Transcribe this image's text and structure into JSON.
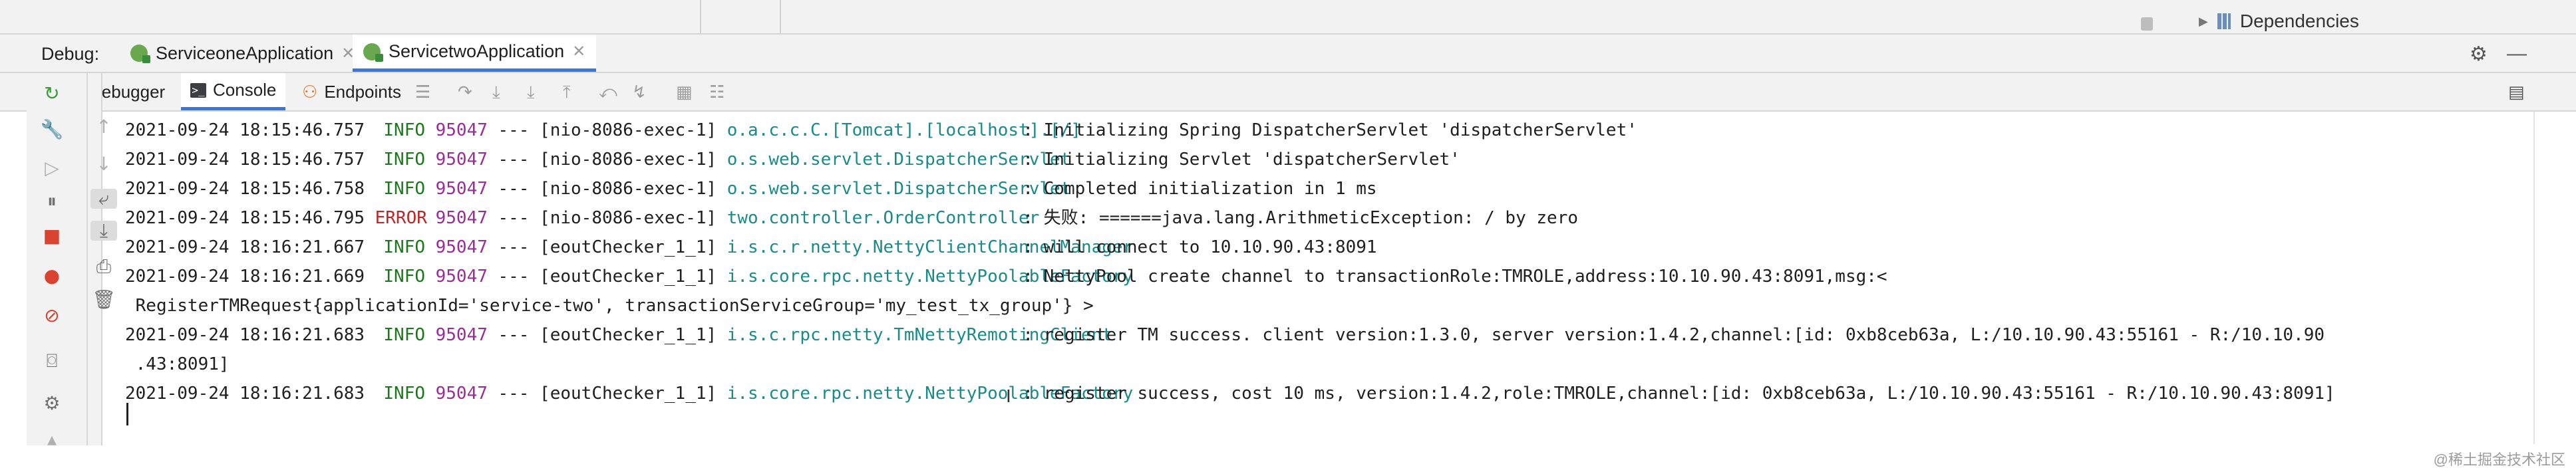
{
  "top": {
    "dependencies_label": "Dependencies"
  },
  "debug_bar": {
    "label": "Debug:",
    "tabs": [
      {
        "name": "ServiceoneApplication",
        "active": false
      },
      {
        "name": "ServicetwoApplication",
        "active": true
      }
    ],
    "right_icons": [
      "gear-icon",
      "minimize-icon"
    ]
  },
  "tool_bar": {
    "tabs": [
      {
        "label": "Debugger",
        "active": false
      },
      {
        "label": "Console",
        "active": true
      },
      {
        "label": "Endpoints",
        "active": false
      }
    ],
    "icons": [
      "menu-icon",
      "step-over-icon",
      "step-into-icon",
      "force-step-into-icon",
      "step-out-icon",
      "drop-frame-icon",
      "run-to-cursor-icon",
      "evaluate-icon",
      "trace-icon",
      "layout-icon"
    ]
  },
  "log": [
    {
      "ts": "2021-09-24 18:15:46.757",
      "level": "INFO",
      "pid": "95047",
      "sep": "---",
      "thread": "[nio-8086-exec-1]",
      "logger": "o.a.c.c.C.[Tomcat].[localhost].[/]",
      "message": ": Initializing Spring DispatcherServlet 'dispatcherServlet'"
    },
    {
      "ts": "2021-09-24 18:15:46.757",
      "level": "INFO",
      "pid": "95047",
      "sep": "---",
      "thread": "[nio-8086-exec-1]",
      "logger": "o.s.web.servlet.DispatcherServlet",
      "message": ": Initializing Servlet 'dispatcherServlet'"
    },
    {
      "ts": "2021-09-24 18:15:46.758",
      "level": "INFO",
      "pid": "95047",
      "sep": "---",
      "thread": "[nio-8086-exec-1]",
      "logger": "o.s.web.servlet.DispatcherServlet",
      "message": ": Completed initialization in 1 ms"
    },
    {
      "ts": "2021-09-24 18:15:46.795",
      "level": "ERROR",
      "pid": "95047",
      "sep": "---",
      "thread": "[nio-8086-exec-1]",
      "logger": "two.controller.OrderController",
      "message": ": 失败: ======java.lang.ArithmeticException: / by zero"
    },
    {
      "ts": "2021-09-24 18:16:21.667",
      "level": "INFO",
      "pid": "95047",
      "sep": "---",
      "thread": "[eoutChecker_1_1]",
      "logger": "i.s.c.r.netty.NettyClientChannelManager",
      "message": ": will connect to 10.10.90.43:8091"
    },
    {
      "ts": "2021-09-24 18:16:21.669",
      "level": "INFO",
      "pid": "95047",
      "sep": "---",
      "thread": "[eoutChecker_1_1]",
      "logger": "i.s.core.rpc.netty.NettyPoolableFactory",
      "message": ": NettyPool create channel to transactionRole:TMROLE,address:10.10.90.43:8091,msg:<"
    },
    {
      "continuation": " RegisterTMRequest{applicationId='service-two', transactionServiceGroup='my_test_tx_group'} >"
    },
    {
      "ts": "2021-09-24 18:16:21.683",
      "level": "INFO",
      "pid": "95047",
      "sep": "---",
      "thread": "[eoutChecker_1_1]",
      "logger": "i.s.c.rpc.netty.TmNettyRemotingClient",
      "message": ": register TM success. client version:1.3.0, server version:1.4.2,channel:[id: 0xb8ceb63a, L:/10.10.90.43:55161 - R:/10.10.90"
    },
    {
      "continuation": " .43:8091]"
    },
    {
      "ts": "2021-09-24 18:16:21.683",
      "level": "INFO",
      "pid": "95047",
      "sep": "---",
      "thread": "[eoutChecker_1_1]",
      "logger": "i.s.core.rpc.netty.NettyPoolableFactory",
      "message": ": register success, cost 10 ms, version:1.4.2,role:TMROLE,channel:[id: 0xb8ceb63a, L:/10.10.90.43:55161 - R:/10.10.90.43:8091]"
    }
  ],
  "watermark": "@稀土掘金技术社区",
  "colors": {
    "info": "#1a7a1a",
    "error": "#c22525",
    "pid": "#9d2a9a",
    "logger": "#1a8a8a",
    "accent": "#3a78d4"
  }
}
